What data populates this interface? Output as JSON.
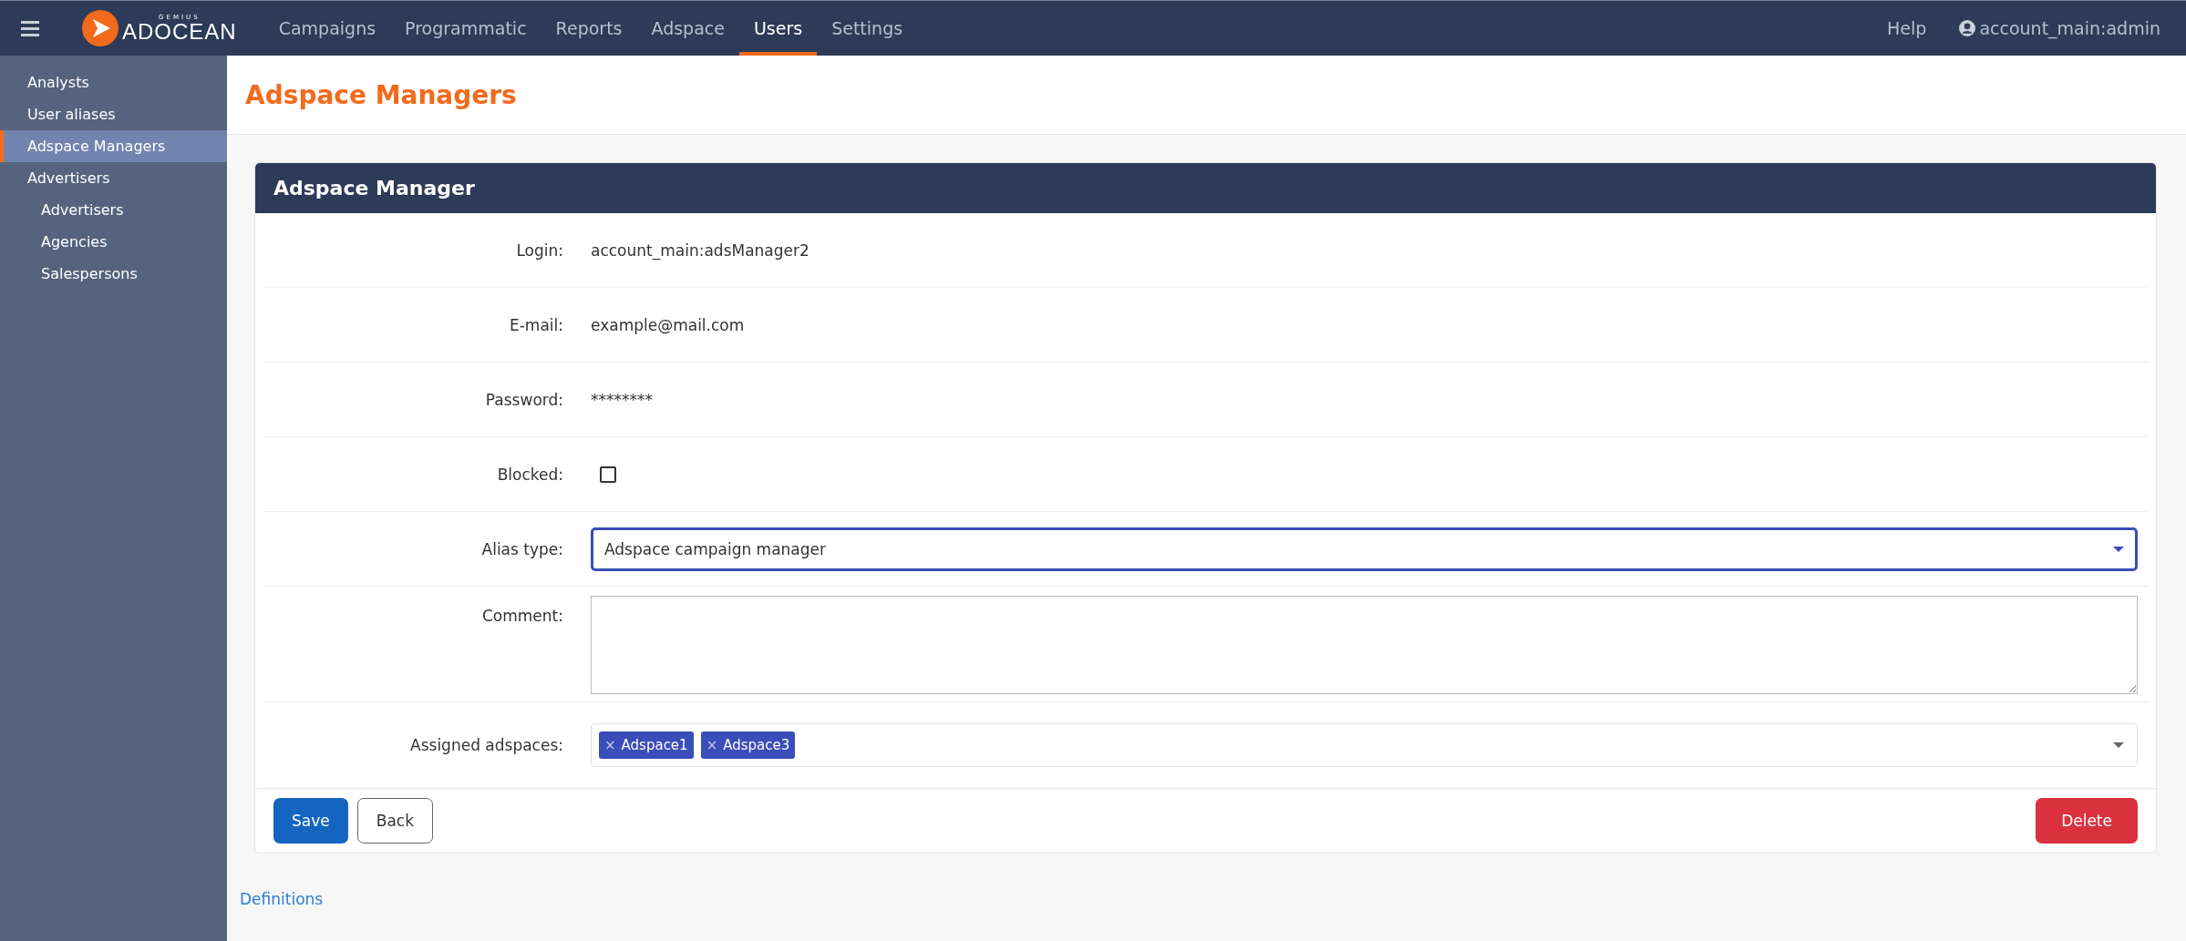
{
  "nav": {
    "brand_small": "GEMIUS",
    "brand": "ADOCEAN",
    "items": [
      {
        "label": "Campaigns",
        "selected": false
      },
      {
        "label": "Programmatic",
        "selected": false
      },
      {
        "label": "Reports",
        "selected": false
      },
      {
        "label": "Adspace",
        "selected": false
      },
      {
        "label": "Users",
        "selected": true
      },
      {
        "label": "Settings",
        "selected": false
      }
    ],
    "help": "Help",
    "user": "account_main:admin"
  },
  "sidebar": {
    "items": [
      {
        "label": "Analysts",
        "selected": false
      },
      {
        "label": "User aliases",
        "selected": false
      },
      {
        "label": "Adspace Managers",
        "selected": true
      },
      {
        "label": "Advertisers",
        "selected": false,
        "children": [
          {
            "label": "Advertisers",
            "selected": false
          },
          {
            "label": "Agencies",
            "selected": false
          },
          {
            "label": "Salespersons",
            "selected": false
          }
        ]
      }
    ]
  },
  "page_title": "Adspace Managers",
  "card": {
    "title": "Adspace Manager",
    "fields": [
      {
        "kind": "text",
        "label": "Login:",
        "value": "account_main:adsManager2"
      },
      {
        "kind": "text",
        "label": "E-mail:",
        "value": "example@mail.com"
      },
      {
        "kind": "text",
        "label": "Password:",
        "value": "********"
      },
      {
        "kind": "checkbox",
        "label": "Blocked:",
        "checked": false
      },
      {
        "kind": "select",
        "label": "Alias type:",
        "value": "Adspace campaign manager",
        "focused": true
      },
      {
        "kind": "textarea",
        "label": "Comment:"
      },
      {
        "kind": "tags",
        "label": "Assigned adspaces:",
        "tags": [
          {
            "remove": "×",
            "label": "Adspace1"
          },
          {
            "remove": "×",
            "label": "Adspace3"
          }
        ]
      }
    ],
    "buttons": [
      {
        "kind": "primary",
        "label": "Save"
      },
      {
        "kind": "secondary",
        "label": "Back"
      },
      {
        "kind": "danger",
        "label": "Delete"
      }
    ]
  },
  "footer_link": "Definitions"
}
